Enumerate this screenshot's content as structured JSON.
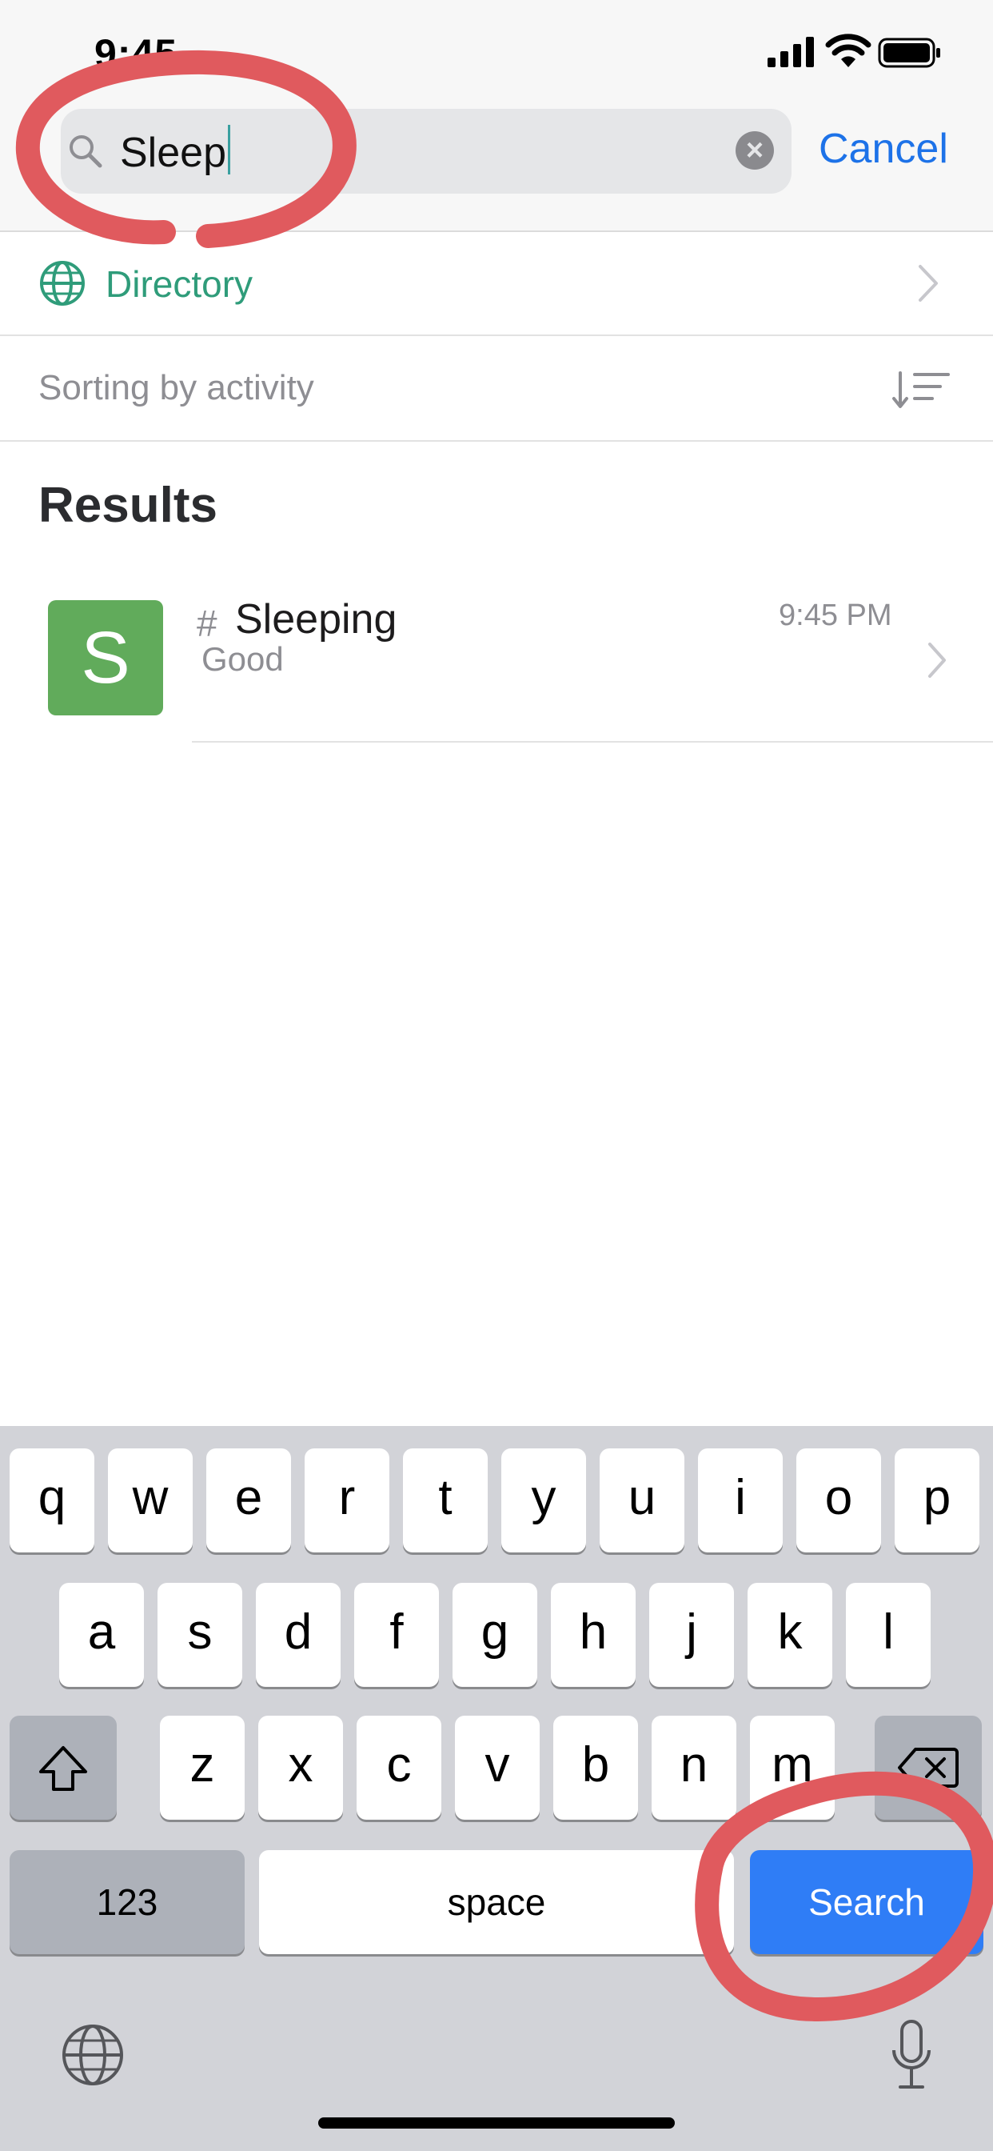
{
  "status_bar": {
    "time": "9:45"
  },
  "search": {
    "query": "Sleep",
    "cancel_label": "Cancel"
  },
  "directory": {
    "label": "Directory"
  },
  "sort": {
    "label": "Sorting by activity"
  },
  "results": {
    "heading": "Results",
    "items": [
      {
        "avatar_letter": "S",
        "avatar_color": "#61ab5b",
        "hash": "#",
        "name": "Sleeping",
        "subtitle": "Good",
        "time": "9:45 PM"
      }
    ]
  },
  "keyboard": {
    "row1": [
      "q",
      "w",
      "e",
      "r",
      "t",
      "y",
      "u",
      "i",
      "o",
      "p"
    ],
    "row2": [
      "a",
      "s",
      "d",
      "f",
      "g",
      "h",
      "j",
      "k",
      "l"
    ],
    "row3": [
      "z",
      "x",
      "c",
      "v",
      "b",
      "n",
      "m"
    ],
    "numbers_label": "123",
    "space_label": "space",
    "search_label": "Search"
  },
  "colors": {
    "accent": "#1d72e8",
    "directory_green": "#2f9c7a",
    "annotation_red": "#e05a5e",
    "search_key": "#2f7df6"
  }
}
